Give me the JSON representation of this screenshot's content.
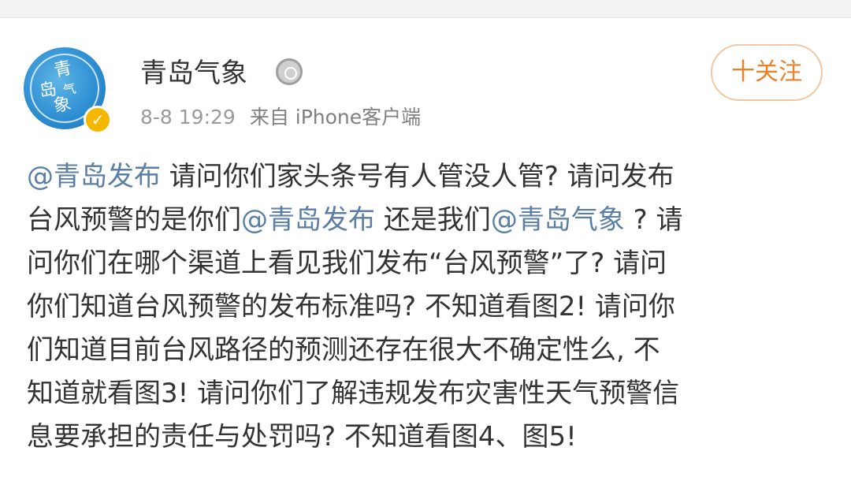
{
  "account": {
    "name": "青岛气象",
    "avatar_text": [
      "青",
      "岛",
      "气",
      "象"
    ],
    "timestamp": "8-8 19:29",
    "source": "来自 iPhone客户端",
    "follow_label": "十关注"
  },
  "post": {
    "lines": [
      [
        {
          "type": "mention",
          "text": "@青岛发布"
        },
        {
          "type": "text",
          "text": " 请问你们家头条号有人管没人管? 请问发布"
        }
      ],
      [
        {
          "type": "text",
          "text": "台风预警的是你们"
        },
        {
          "type": "mention",
          "text": "@青岛发布"
        },
        {
          "type": "text",
          "text": " 还是我们"
        },
        {
          "type": "mention",
          "text": "@青岛气象"
        },
        {
          "type": "text",
          "text": " ? 请"
        }
      ],
      [
        {
          "type": "text",
          "text": "问你们在哪个渠道上看见我们发布“台风预警”了? 请问"
        }
      ],
      [
        {
          "type": "text",
          "text": "你们知道台风预警的发布标准吗? 不知道看图2! 请问你"
        }
      ],
      [
        {
          "type": "text",
          "text": "们知道目前台风路径的预测还存在很大不确定性么, 不"
        }
      ],
      [
        {
          "type": "text",
          "text": "知道就看图3! 请问你们了解违规发布灾害性天气预警信"
        }
      ],
      [
        {
          "type": "text",
          "text": "息要承担的责任与处罚吗? 不知道看图4、图5!"
        }
      ]
    ]
  },
  "colors": {
    "mention": "#5b7ea5",
    "follow_text": "#e9822b",
    "follow_border": "#f0c9a4",
    "meta_text": "#9a9a9a",
    "body_text": "#333333"
  },
  "icons": {
    "avatar": "qingdao-weather-logo",
    "verified": "verified-badge-icon",
    "medal": "medal-icon"
  }
}
